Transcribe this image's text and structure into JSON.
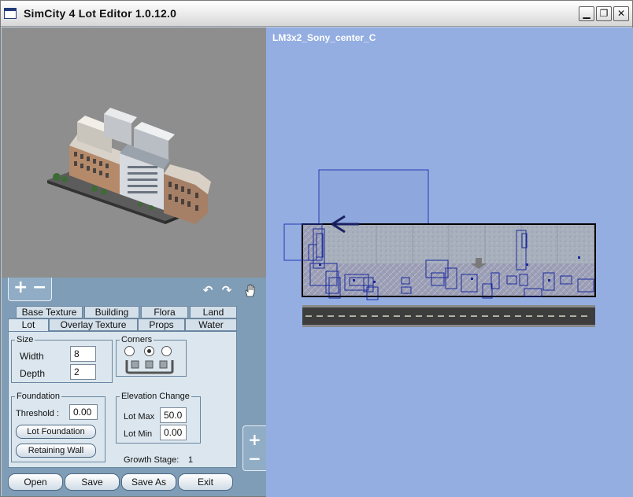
{
  "window": {
    "title": "SimCity 4 Lot Editor 1.0.12.0",
    "minimize_glyph": "▁",
    "maximize_glyph": "❐",
    "close_glyph": "✕"
  },
  "preview": {
    "zoom_in": "+",
    "zoom_out": "−",
    "rotate_left": "↶",
    "rotate_right": "↷",
    "pan_icon": "hand-icon"
  },
  "tabs": {
    "row1": [
      "Base Texture",
      "Building",
      "Flora",
      "Land"
    ],
    "row2": [
      "Lot",
      "Overlay Texture",
      "Props",
      "Water"
    ],
    "active": "Lot"
  },
  "size": {
    "legend": "Size",
    "width_label": "Width",
    "width_value": "8",
    "depth_label": "Depth",
    "depth_value": "2"
  },
  "corners": {
    "legend": "Corners",
    "selected_index": 1
  },
  "foundation": {
    "legend": "Foundation",
    "threshold_label": "Threshold :",
    "threshold_value": "0.00",
    "lot_foundation_button": "Lot Foundation",
    "retaining_wall_button": "Retaining Wall"
  },
  "elevation": {
    "legend": "Elevation Change",
    "lot_max_label": "Lot Max",
    "lot_max_value": "50.0",
    "lot_min_label": "Lot Min",
    "lot_min_value": "0.00"
  },
  "growth": {
    "label": "Growth Stage:",
    "value": "1"
  },
  "bottom_buttons": {
    "open": "Open",
    "save": "Save",
    "save_as": "Save As",
    "exit": "Exit"
  },
  "lot_view": {
    "lot_name": "LM3x2_Sony_center_C",
    "zoom_in": "+",
    "zoom_out": "−"
  },
  "colors": {
    "view_background": "#94aee2",
    "panel_background": "#7f9db6",
    "prop_outline": "#1a2a9c"
  }
}
